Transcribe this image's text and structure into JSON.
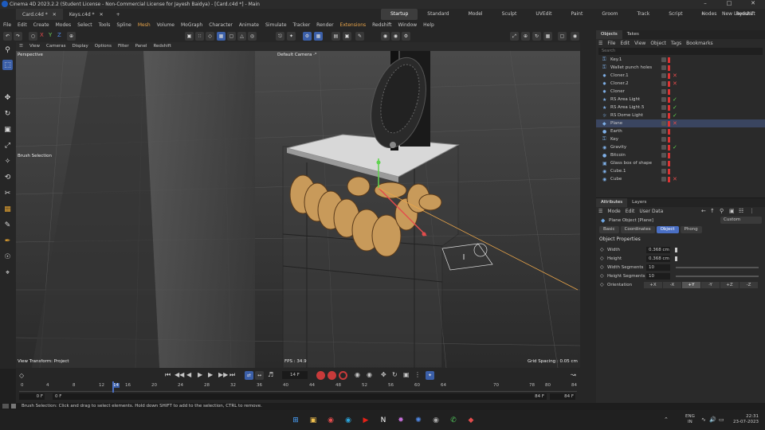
{
  "window": {
    "title": "Cinema 4D 2023.2.2 (Student License - Non-Commercial License for Jayesh Baidya) - [Card.c4d *] - Main"
  },
  "doc_tabs": [
    {
      "label": "Card.c4d *"
    },
    {
      "label": "Keys.c4d *"
    }
  ],
  "layouts": {
    "items": [
      "Startup",
      "Standard",
      "Model",
      "Sculpt",
      "UVEdit",
      "Paint",
      "Groom",
      "Track",
      "Script",
      "Nodes",
      "Redshift"
    ],
    "new_label": "New Layouts"
  },
  "menu": [
    "File",
    "Edit",
    "Create",
    "Modes",
    "Select",
    "Tools",
    "Spline",
    "Mesh",
    "Volume",
    "MoGraph",
    "Character",
    "Animate",
    "Simulate",
    "Tracker",
    "Render",
    "Extensions",
    "Redshift",
    "Window",
    "Help"
  ],
  "toolbar": {
    "axis_x": "X",
    "axis_y": "Y",
    "axis_z": "Z"
  },
  "viewport": {
    "menu": [
      "View",
      "Cameras",
      "Display",
      "Options",
      "Filter",
      "Panel",
      "Redshift"
    ],
    "name": "Perspective",
    "camera": "Default Camera ·°",
    "tool_label": "Brush Selection",
    "view_transform": "View Transform: Project",
    "fps": "FPS : 34.9",
    "grid_spacing": "Grid Spacing : 0.05 cm"
  },
  "timeline": {
    "current_frame": "14 F",
    "start_field": "0 F",
    "start_field2": "0 F",
    "end_field": "84 F",
    "end_field2": "84 F",
    "ticks": [
      "0",
      "4",
      "8",
      "12",
      "14",
      "16",
      "20",
      "24",
      "28",
      "32",
      "36",
      "40",
      "44",
      "48",
      "52",
      "56",
      "60",
      "64",
      "70",
      "78",
      "80",
      "84"
    ]
  },
  "status": {
    "text": "Brush Selection: Click and drag to select elements. Hold down SHIFT to add to the selection, CTRL to remove."
  },
  "objects_panel": {
    "tabs": [
      "Objects",
      "Takes"
    ],
    "menu": [
      "File",
      "Edit",
      "View",
      "Object",
      "Tags",
      "Bookmarks"
    ],
    "search_placeholder": "Search",
    "items": [
      {
        "name": "Key.1",
        "vis": "red"
      },
      {
        "name": "Wallet punch holes",
        "vis": "red"
      },
      {
        "name": "Cloner.1",
        "vis": "red",
        "x": "✕"
      },
      {
        "name": "Cloner.2",
        "vis": "red",
        "x": "✕"
      },
      {
        "name": "Cloner",
        "vis": "red"
      },
      {
        "name": "RS Area Light",
        "vis": "red",
        "x": "✓"
      },
      {
        "name": "RS Area Light.5",
        "vis": "red",
        "x": "✓"
      },
      {
        "name": "RS Dome Light",
        "vis": "red",
        "x": "✓"
      },
      {
        "name": "Plane",
        "vis": "red",
        "x": "✕",
        "sel": true
      },
      {
        "name": "Earth",
        "vis": "red"
      },
      {
        "name": "Key",
        "vis": "red"
      },
      {
        "name": "Gravity",
        "vis": "red",
        "x": "✓"
      },
      {
        "name": "Bitcoin",
        "vis": "red"
      },
      {
        "name": "Glass box of shape",
        "vis": "red"
      },
      {
        "name": "Cube.1",
        "vis": "red"
      },
      {
        "name": "Cube",
        "vis": "red",
        "x": "✕"
      }
    ]
  },
  "attributes_panel": {
    "tabs": [
      "Attributes",
      "Layers"
    ],
    "menu": [
      "Mode",
      "Edit",
      "User Data"
    ],
    "object_title": "Plane Object [Plane]",
    "preset": "Custom",
    "subtabs": [
      "Basic",
      "Coordinates",
      "Object",
      "Phong"
    ],
    "section": "Object Properties",
    "fields": [
      {
        "label": "Width",
        "value": "0.368 cm"
      },
      {
        "label": "Height",
        "value": "0.368 cm"
      },
      {
        "label": "Width Segments",
        "value": "10"
      },
      {
        "label": "Height Segments",
        "value": "10"
      }
    ],
    "orientation_label": "Orientation",
    "orientation": [
      "+X",
      "-X",
      "+Y",
      "-Y",
      "+Z",
      "-Z"
    ]
  },
  "taskbar": {
    "lang1": "ENG",
    "lang2": "IN",
    "time": "22:31",
    "date": "23-07-2023"
  },
  "colors": {
    "accent": "#4a6fc4",
    "highlight_menu": "#e9a54a",
    "record": "#c83a3a"
  }
}
